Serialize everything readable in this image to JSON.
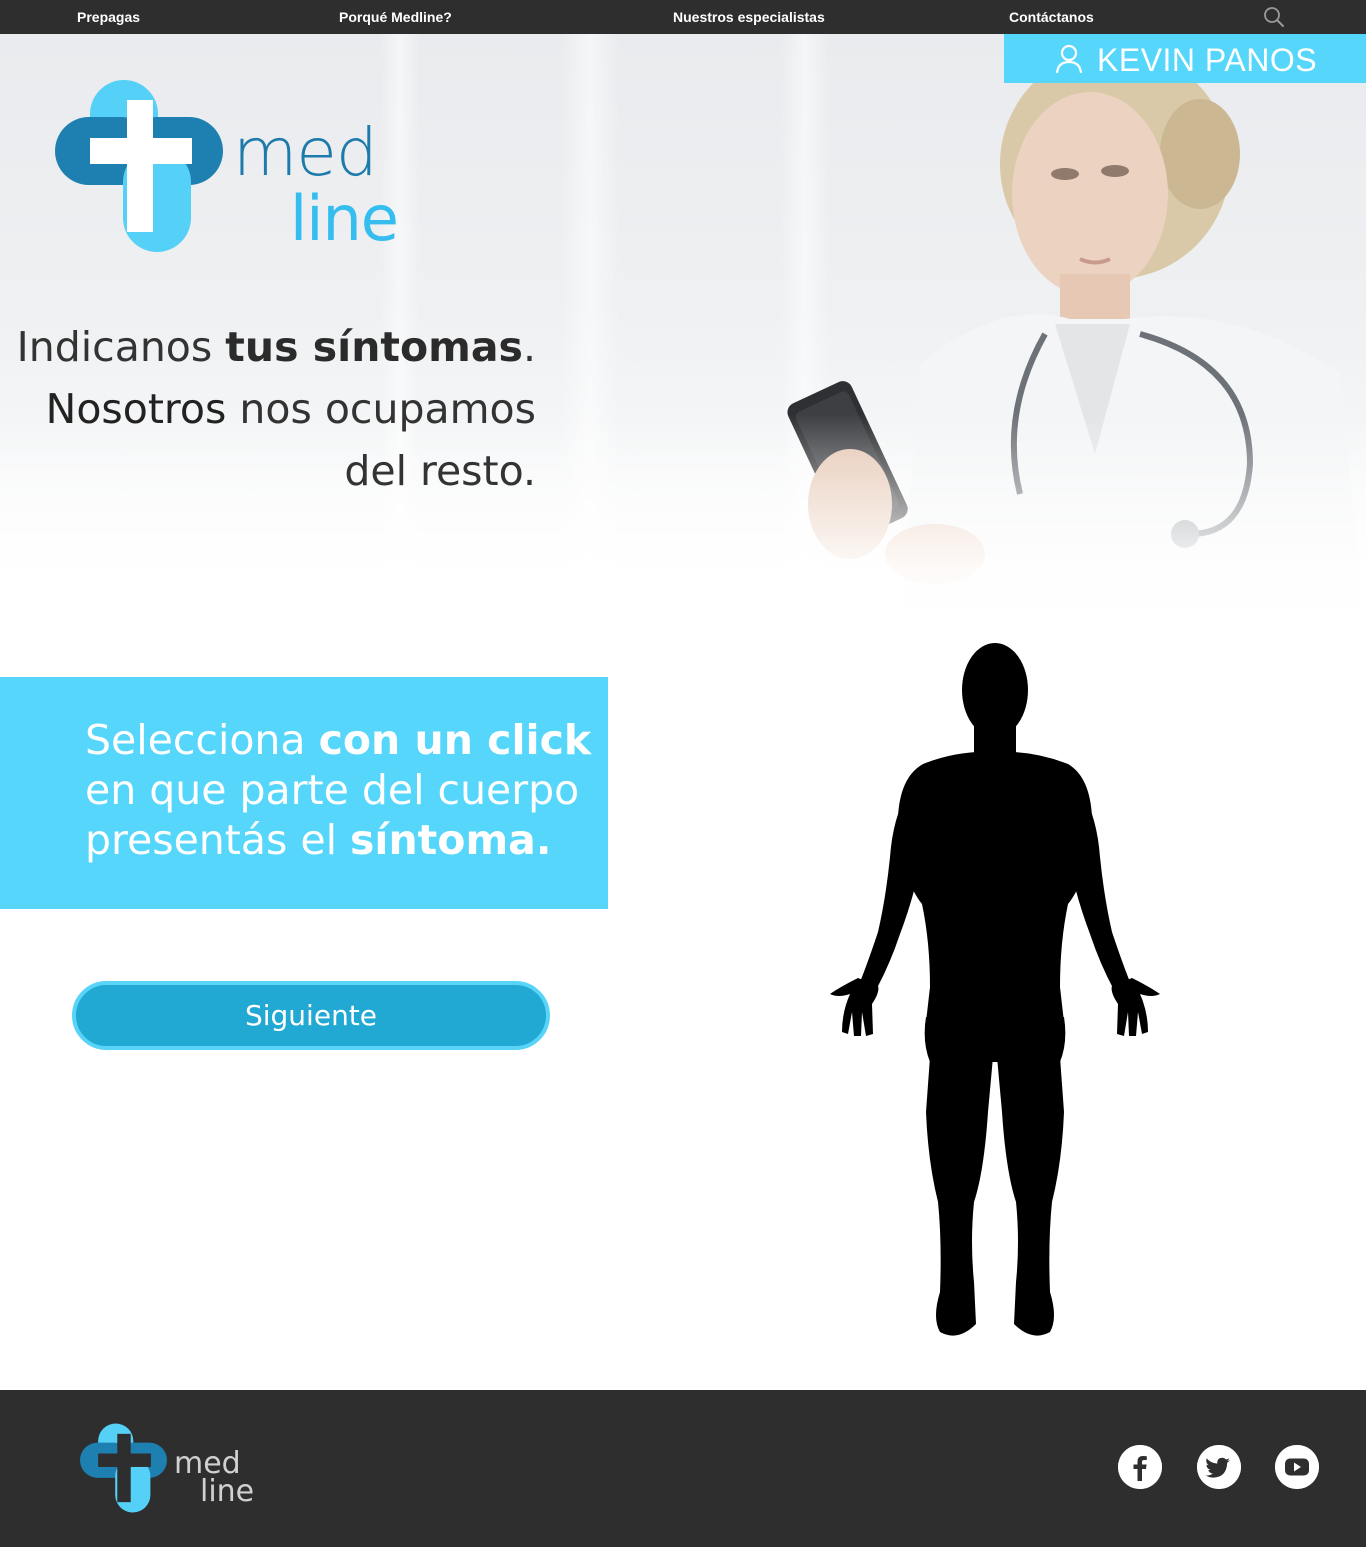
{
  "nav": {
    "items": [
      "Prepagas",
      "Porqué Medline?",
      "Nuestros especialistas",
      "Contáctanos"
    ]
  },
  "user": {
    "name": "KEVIN PANOS"
  },
  "logo": {
    "med": "med",
    "line": "line"
  },
  "hero": {
    "line1_a": "Indicanos ",
    "line1_b": "tus síntomas",
    "line1_c": ".",
    "line2_a": "Nosotros",
    "line2_b": " nos ocupamos",
    "line3": "del resto."
  },
  "instruction": {
    "l1_a": "Selecciona ",
    "l1_b": "con un click",
    "l2": "en que parte del cuerpo",
    "l3_a": "presentás el ",
    "l3_b": "síntoma."
  },
  "button": {
    "next_label": "Siguiente"
  },
  "icons": {
    "search": "search-icon",
    "user": "user-icon",
    "social": [
      "facebook-icon",
      "twitter-icon",
      "youtube-icon"
    ]
  },
  "colors": {
    "nav_bg": "#2e2e2e",
    "accent": "#55d6fa",
    "button": "#22a9d3",
    "logo_dark": "#1d7bab",
    "logo_light": "#35bdf0"
  }
}
